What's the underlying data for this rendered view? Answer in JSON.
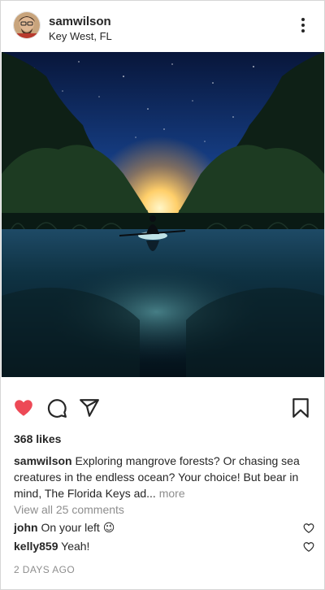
{
  "post": {
    "username": "samwilson",
    "location": "Key West, FL",
    "likes_text": "368 likes",
    "liked": true,
    "caption": {
      "username": "samwilson",
      "text": "Exploring mangrove forests? Or chasing sea creatures in the endless ocean? Your choice! But bear in mind, The Florida Keys ad...",
      "more_label": "more"
    },
    "view_all_comments": "View all 25 comments",
    "comments": [
      {
        "username": "john",
        "text": "On your left 😉"
      },
      {
        "username": "kelly859",
        "text": "Yeah!"
      }
    ],
    "timestamp": "2 DAYS AGO"
  },
  "icons": {
    "more": "more-vertical-icon",
    "like": "heart-icon",
    "comment": "comment-icon",
    "share": "send-icon",
    "save": "bookmark-icon"
  },
  "colors": {
    "like_red": "#ed4956",
    "text": "#262626",
    "muted": "#8e8e8e"
  }
}
